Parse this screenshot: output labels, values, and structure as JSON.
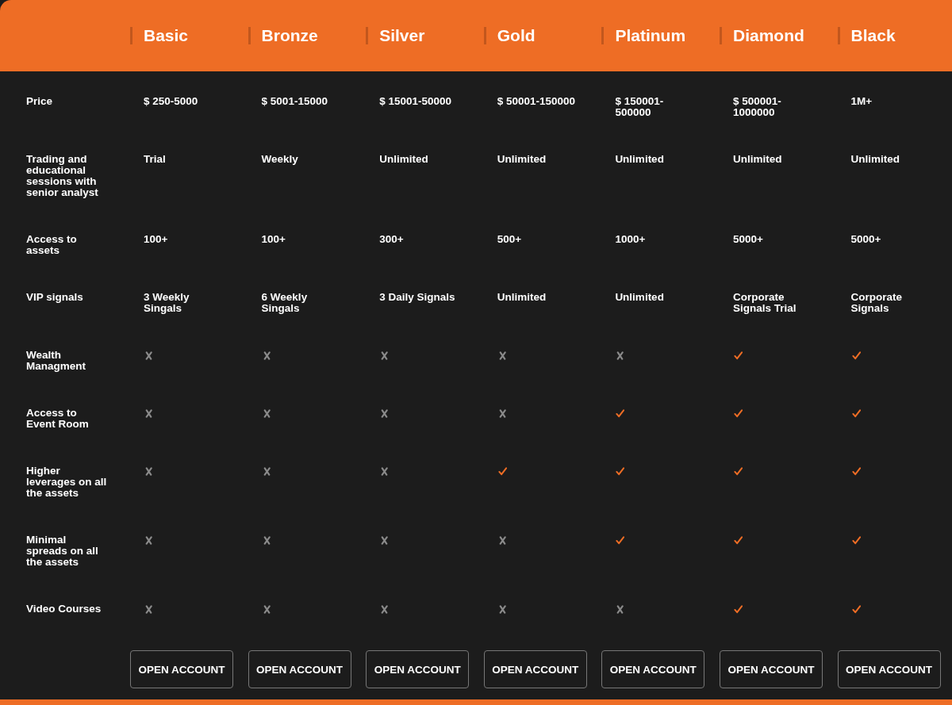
{
  "plans": [
    "Basic",
    "Bronze",
    "Silver",
    "Gold",
    "Platinum",
    "Diamond",
    "Black"
  ],
  "rows": [
    {
      "kind": "text",
      "label": "Price",
      "values": [
        "$ 250-5000",
        "$ 5001-15000",
        "$ 15001-50000",
        "$ 50001-150000",
        "$ 150001-500000",
        "$ 500001-1000000",
        "1M+"
      ]
    },
    {
      "kind": "text",
      "label": "Trading and educational sessions with senior analyst",
      "values": [
        "Trial",
        "Weekly",
        "Unlimited",
        "Unlimited",
        "Unlimited",
        "Unlimited",
        "Unlimited"
      ]
    },
    {
      "kind": "text",
      "label": "Access to assets",
      "values": [
        "100+",
        "100+",
        "300+",
        "500+",
        "1000+",
        "5000+",
        "5000+"
      ]
    },
    {
      "kind": "text",
      "label": "VIP signals",
      "values": [
        "3 Weekly Singals",
        "6 Weekly Singals",
        "3 Daily Signals",
        "Unlimited",
        "Unlimited",
        "Corporate Signals Trial",
        "Corporate Signals"
      ]
    },
    {
      "kind": "feature",
      "label": "Wealth Managment",
      "cells": [
        {
          "included": false
        },
        {
          "included": false
        },
        {
          "included": false
        },
        {
          "included": false
        },
        {
          "included": false
        },
        {
          "included": true
        },
        {
          "included": true
        }
      ]
    },
    {
      "kind": "feature",
      "label": "Access to Event Room",
      "cells": [
        {
          "included": false
        },
        {
          "included": false
        },
        {
          "included": false
        },
        {
          "included": false
        },
        {
          "included": true
        },
        {
          "included": true
        },
        {
          "included": true
        }
      ]
    },
    {
      "kind": "feature",
      "label": "Higher leverages on all the assets",
      "cells": [
        {
          "included": false
        },
        {
          "included": false
        },
        {
          "included": false
        },
        {
          "included": true
        },
        {
          "included": true
        },
        {
          "included": true
        },
        {
          "included": true
        }
      ]
    },
    {
      "kind": "feature",
      "label": "Minimal spreads on all the assets",
      "cells": [
        {
          "included": false
        },
        {
          "included": false
        },
        {
          "included": false
        },
        {
          "included": false
        },
        {
          "included": true
        },
        {
          "included": true
        },
        {
          "included": true
        }
      ]
    },
    {
      "kind": "feature",
      "label": "Video Courses",
      "cells": [
        {
          "included": false
        },
        {
          "included": false
        },
        {
          "included": false
        },
        {
          "included": false
        },
        {
          "included": false
        },
        {
          "included": true
        },
        {
          "included": true
        }
      ]
    }
  ],
  "buttons": [
    "OPEN ACCOUNT",
    "OPEN ACCOUNT",
    "OPEN ACCOUNT",
    "OPEN ACCOUNT",
    "OPEN ACCOUNT",
    "OPEN ACCOUNT",
    "OPEN ACCOUNT"
  ]
}
